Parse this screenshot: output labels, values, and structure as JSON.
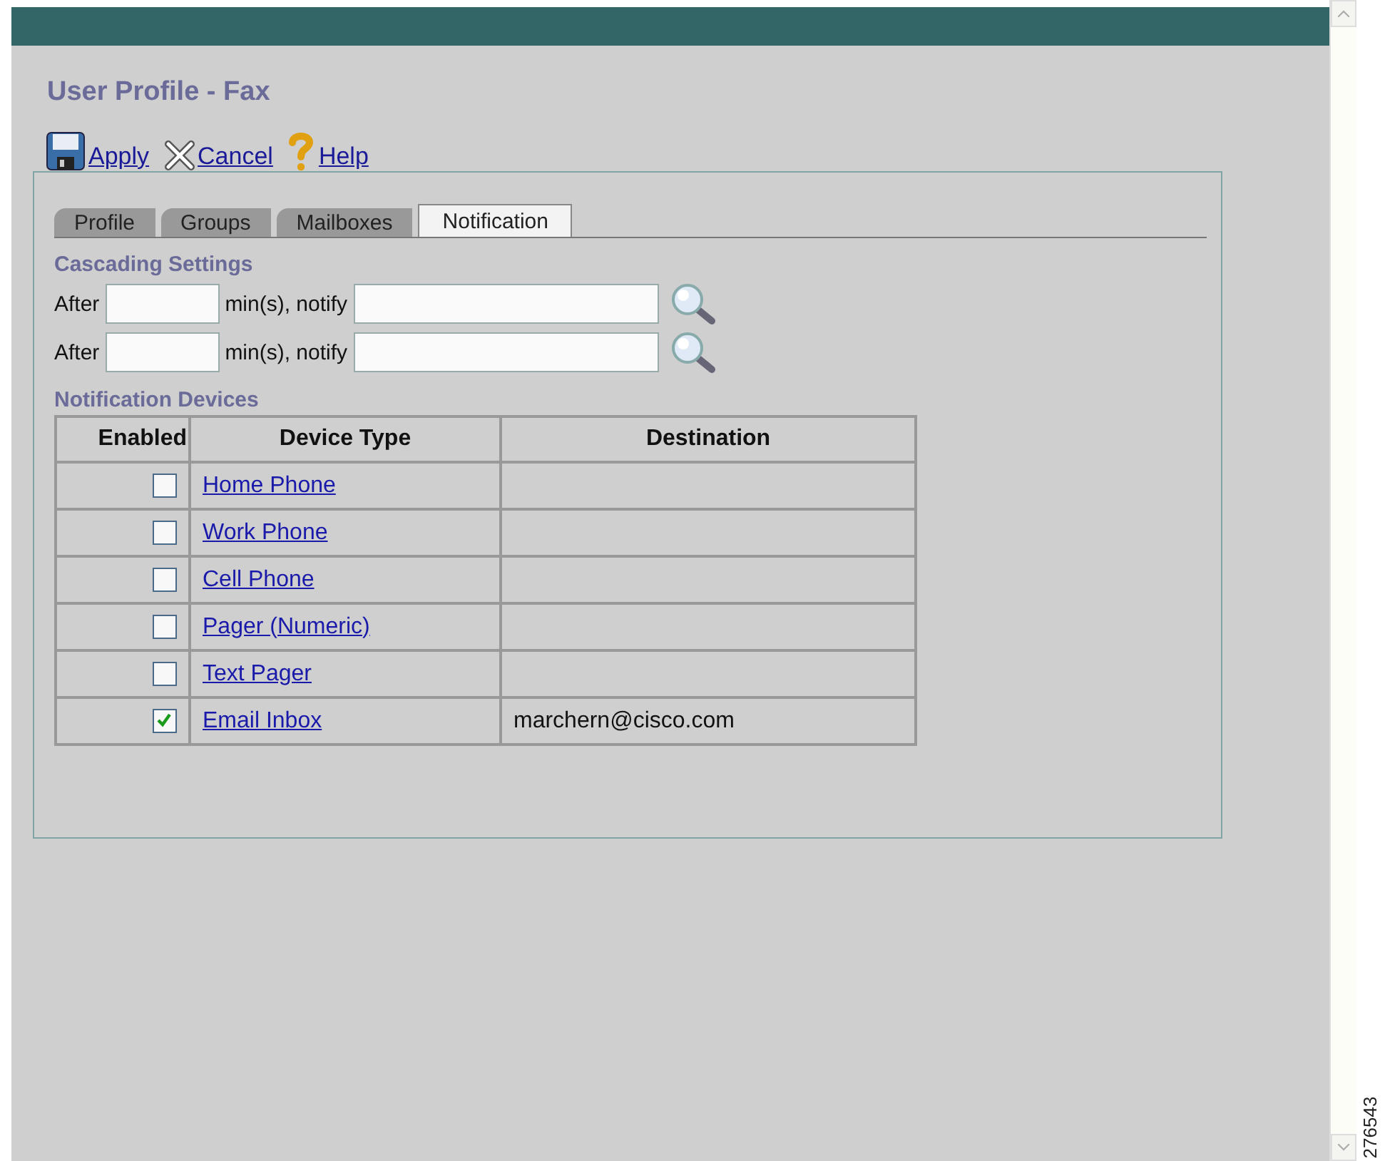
{
  "page_title": "User Profile - Fax",
  "toolbar": [
    {
      "kind": "save",
      "label": "Apply"
    },
    {
      "kind": "cancel",
      "label": "Cancel"
    },
    {
      "kind": "help",
      "label": "Help"
    }
  ],
  "tabs": [
    {
      "label": "Profile",
      "selected": false
    },
    {
      "label": "Groups",
      "selected": false
    },
    {
      "label": "Mailboxes",
      "selected": false
    },
    {
      "label": "Notification",
      "selected": true
    }
  ],
  "cascading": {
    "heading": "Cascading Settings",
    "rows": [
      {
        "after_label": "After",
        "mins_label": "min(s), notify"
      },
      {
        "after_label": "After",
        "mins_label": "min(s), notify"
      }
    ]
  },
  "devices": {
    "heading": "Notification Devices",
    "columns": [
      "Enabled",
      "Device Type",
      "Destination"
    ],
    "rows": [
      {
        "checked": false,
        "device": "Home Phone"
      },
      {
        "checked": false,
        "device": "Work Phone"
      },
      {
        "checked": false,
        "device": "Cell Phone"
      },
      {
        "checked": false,
        "device": "Pager (Numeric)"
      },
      {
        "checked": false,
        "device": "Text Pager"
      },
      {
        "checked": true,
        "device": "Email Inbox",
        "destination": "marchern@cisco.com"
      }
    ]
  },
  "figure_number": "276543"
}
